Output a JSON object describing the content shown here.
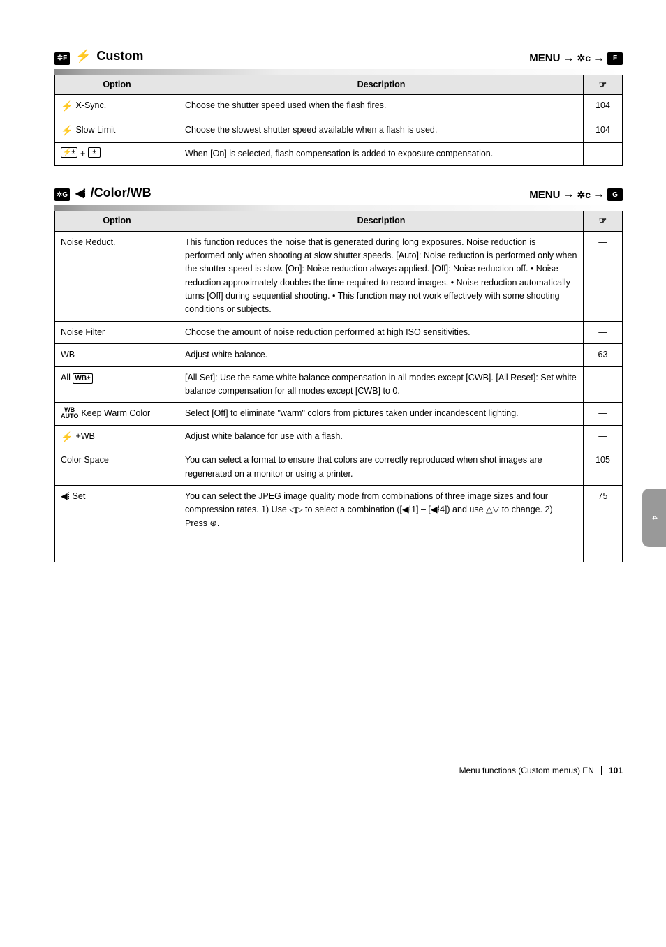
{
  "sectionF": {
    "tab": "✲F",
    "icon": "⚡",
    "title": "Custom",
    "pathPrefix": "MENU",
    "pathGear": "✲c",
    "pathEnd": "F",
    "headers": {
      "option": "Option",
      "description": "Description",
      "ref": "☞"
    },
    "rows": [
      {
        "icon": "⚡",
        "name": "X-Sync.",
        "desc": "Choose the shutter speed used when the flash fires.",
        "ref": "104"
      },
      {
        "icon": "⚡",
        "name": "Slow Limit",
        "desc": "Choose the slowest shutter speed available when a flash is used.",
        "ref": "104"
      },
      {
        "icons": [
          "⚡±",
          "±"
        ],
        "name": "",
        "desc": "When [On] is selected, flash compensation is added to exposure compensation.",
        "ref": "—"
      }
    ]
  },
  "sectionG": {
    "tab": "✲G",
    "icon": "◀⁞",
    "title": "/Color/WB",
    "pathPrefix": "MENU",
    "pathGear": "✲c",
    "pathEnd": "G",
    "headers": {
      "option": "Option",
      "description": "Description",
      "ref": "☞"
    },
    "rows": [
      {
        "name": "Noise Reduct.",
        "desc": "This function reduces the noise that is generated during long exposures. Noise reduction is performed only when shooting at slow shutter speeds. [Auto]: Noise reduction is performed only when the shutter speed is slow. [On]: Noise reduction always applied. [Off]: Noise reduction off. • Noise reduction approximately doubles the time required to record images. • Noise reduction automatically turns [Off] during sequential shooting. • This function may not work effectively with some shooting conditions or subjects.",
        "ref": "—"
      },
      {
        "name": "Noise Filter",
        "desc": "Choose the amount of noise reduction performed at high ISO sensitivities.",
        "ref": "—"
      },
      {
        "name": "WB",
        "desc": "Adjust white balance.",
        "ref": "63"
      },
      {
        "name": "All ",
        "boxed": "WB±",
        "desc": "[All Set]: Use the same white balance compensation in all modes except [CWB]. [All Reset]: Set white balance compensation for all modes except [CWB] to 0.",
        "ref": "—"
      },
      {
        "prefix": "WB\nAUTO",
        "name": " Keep Warm Color",
        "desc": "Select [Off] to eliminate \"warm\" colors from pictures taken under incandescent lighting.",
        "ref": "—"
      },
      {
        "icon": "⚡",
        "name": "+WB",
        "desc": "Adjust white balance for use with a flash.",
        "ref": "—"
      },
      {
        "name": "Color Space",
        "desc": "You can select a format to ensure that colors are correctly reproduced when shot images are regenerated on a monitor or using a printer.",
        "ref": "105"
      },
      {
        "name": "◀⁞  Set",
        "desc": "You can select the JPEG image quality mode from combinations of three image sizes and four compression rates. 1) Use ◁▷ to select a combination ([◀⁞1] – [◀⁞4]) and use △▽ to change. 2) Press ⊛.",
        "ref": "75",
        "hasImage": true
      }
    ]
  },
  "sideTab": "4",
  "footer": {
    "label": "Menu functions (Custom menus) EN",
    "page": "101"
  }
}
